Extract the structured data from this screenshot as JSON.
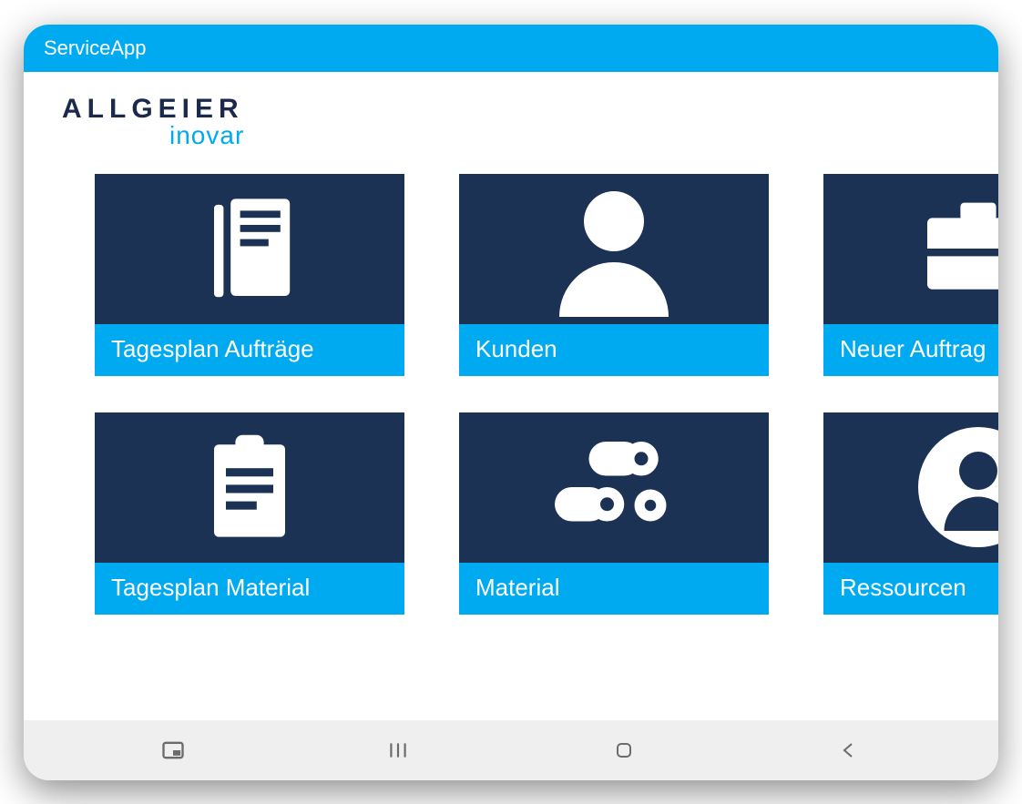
{
  "app": {
    "title": "ServiceApp"
  },
  "brand": {
    "line1": "ALLGEIER",
    "line2": "inovar"
  },
  "tiles": [
    {
      "id": "tagesplan-auftraege",
      "label": "Tagesplan Aufträge",
      "icon": "document"
    },
    {
      "id": "kunden",
      "label": "Kunden",
      "icon": "person"
    },
    {
      "id": "neuer-auftrag",
      "label": "Neuer Auftrag",
      "icon": "briefcase"
    },
    {
      "id": "tagesplan-material",
      "label": "Tagesplan Material",
      "icon": "clipboard"
    },
    {
      "id": "material",
      "label": "Material",
      "icon": "rolls"
    },
    {
      "id": "ressourcen",
      "label": "Ressourcen",
      "icon": "resource-person"
    }
  ],
  "nav": {
    "pip": "pip-icon",
    "recent": "recent-apps-icon",
    "home": "home-icon",
    "back": "back-icon"
  }
}
